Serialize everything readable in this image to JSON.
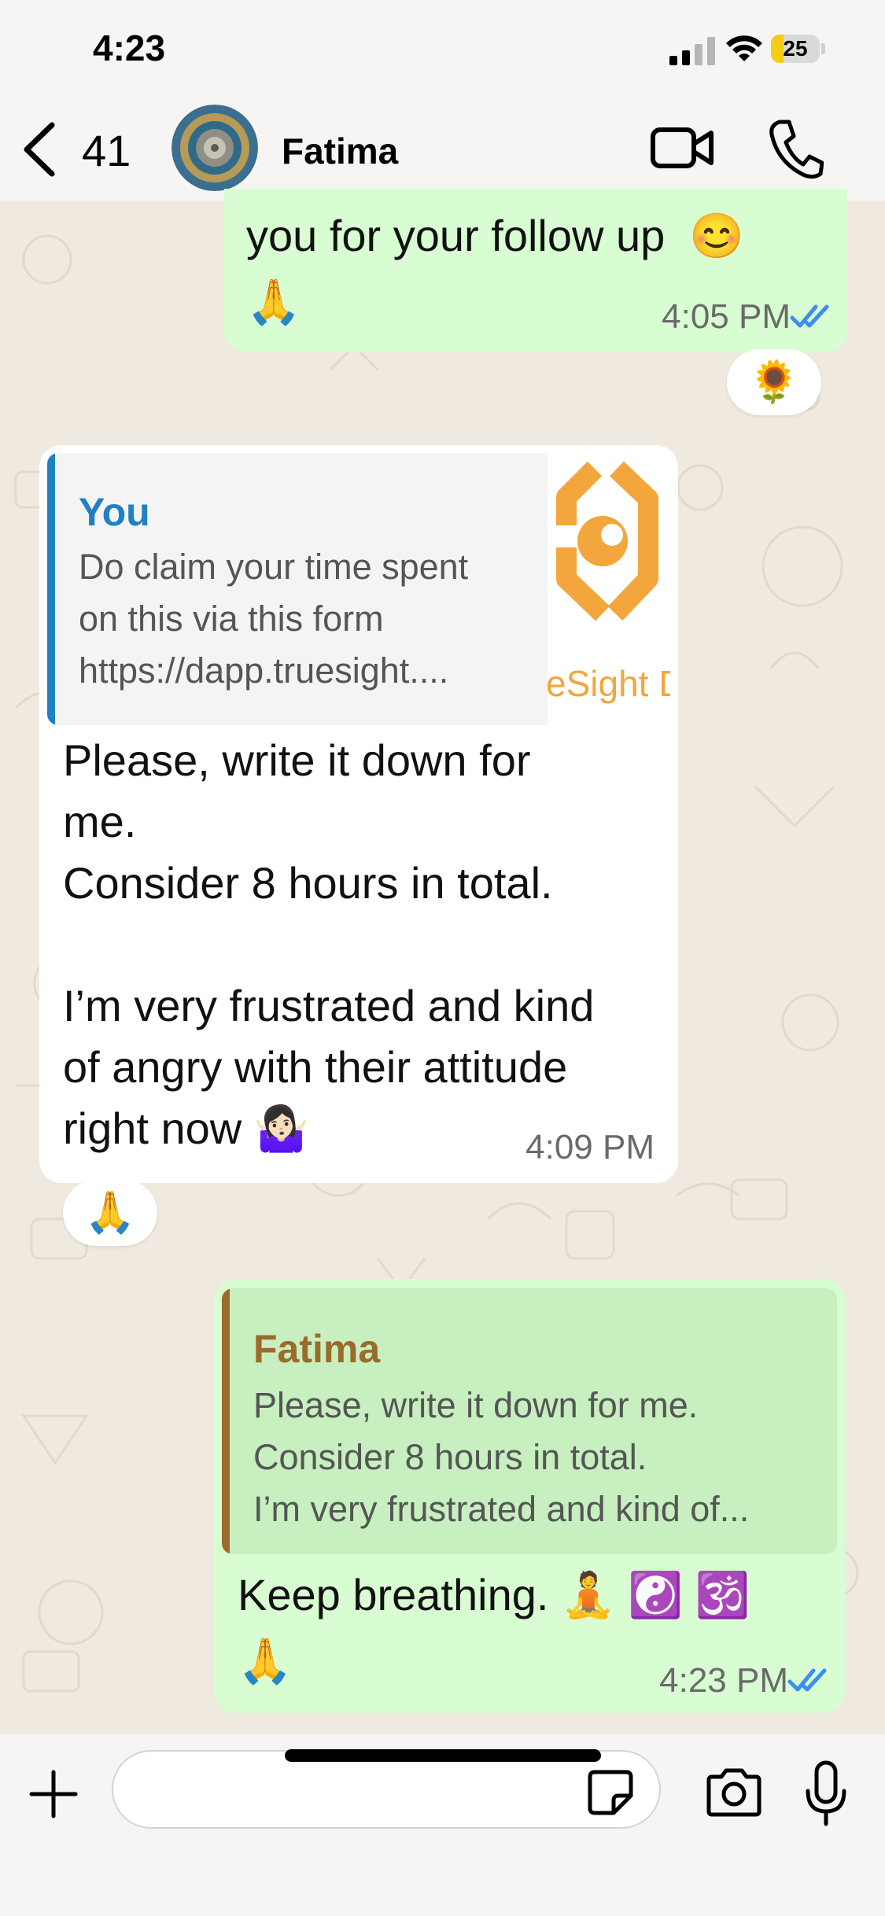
{
  "status_bar": {
    "time": "4:23",
    "battery": "25",
    "battery_level": 0.25
  },
  "header": {
    "back_count": "41",
    "contact_name": "Fatima"
  },
  "messages": [
    {
      "direction": "outgoing",
      "text": "you for your follow up  😊\n🙏",
      "time": "4:05 PM",
      "status": "read",
      "reaction": "🌻"
    },
    {
      "direction": "incoming",
      "quote": {
        "author": "You",
        "text": "Do claim your time spent\non this via this form\nhttps://dapp.truesight....",
        "thumbnail_caption": "eSight D"
      },
      "text": "Please, write it down for\nme.\nConsider 8 hours in total.\n\nI’m very frustrated and kind\nof angry with their attitude\nright now 🤷🏻‍♀️",
      "time": "4:09 PM",
      "reaction": "🙏"
    },
    {
      "direction": "outgoing",
      "quote": {
        "author": "Fatima",
        "text": "Please, write it down for me.\nConsider 8 hours in total.\nI’m very frustrated and kind of..."
      },
      "text": "Keep breathing. 🧘 ☯️ 🕉️\n🙏",
      "time": "4:23 PM",
      "status": "read"
    }
  ],
  "composer": {
    "placeholder": ""
  },
  "colors": {
    "outgoing_bubble": "#d8fdd2",
    "incoming_bubble": "#ffffff",
    "read_ticks": "#3d8ef2",
    "quote_you": "#1f80c4",
    "quote_fatima": "#9a6b2a"
  }
}
